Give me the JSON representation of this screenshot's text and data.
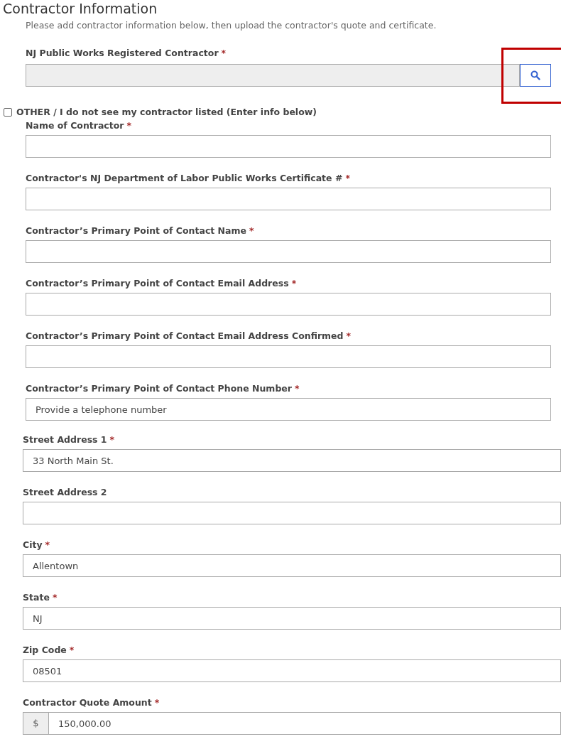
{
  "section": {
    "title": "Contractor Information",
    "description": "Please add contractor information below, then upload the contractor's quote and certificate."
  },
  "lookup": {
    "label": "NJ Public Works Registered Contractor",
    "required_mark": "*",
    "disabled": true,
    "highlighted": true
  },
  "other_checkbox": {
    "label": "OTHER / I do not see my contractor listed (Enter info below)",
    "checked": false
  },
  "contact_fields": [
    {
      "label": "Name of Contractor",
      "required_mark": "*",
      "kind": "text"
    },
    {
      "label": "Contractor's NJ Department of Labor Public Works Certificate #",
      "required_mark": "*",
      "kind": "text"
    },
    {
      "label": "Contractor’s Primary Point of Contact Name",
      "required_mark": "*",
      "kind": "text"
    },
    {
      "label": "Contractor’s Primary Point of Contact Email Address",
      "required_mark": "*",
      "kind": "text"
    },
    {
      "label": "Contractor’s Primary Point of Contact Email Address Confirmed",
      "required_mark": "*",
      "kind": "text"
    },
    {
      "label": "Contractor’s Primary Point of Contact Phone Number",
      "required_mark": "*",
      "kind": "text",
      "value": "Provide a telephone number"
    }
  ],
  "address_fields": [
    {
      "label": "Street Address 1",
      "required_mark": "*",
      "kind": "text",
      "value": "33 North Main St."
    },
    {
      "label": "Street Address 2",
      "kind": "text"
    },
    {
      "label": "City",
      "required_mark": "*",
      "kind": "text",
      "value": "Allentown"
    },
    {
      "label": "State",
      "required_mark": "*",
      "kind": "text",
      "value": "NJ"
    },
    {
      "label": "Zip Code",
      "required_mark": "*",
      "kind": "text",
      "value": "08501"
    },
    {
      "label": "Contractor Quote Amount",
      "required_mark": "*",
      "kind": "currency",
      "prefix": "$",
      "value": "150,000.00"
    }
  ]
}
